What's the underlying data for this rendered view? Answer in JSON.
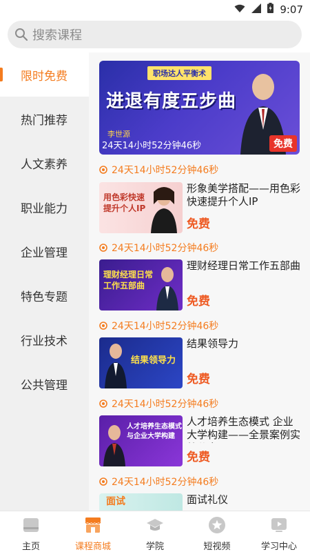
{
  "status_bar": {
    "time": "9:07"
  },
  "search": {
    "placeholder": "搜索课程"
  },
  "sidebar": {
    "items": [
      {
        "label": "限时免费",
        "active": true
      },
      {
        "label": "热门推荐"
      },
      {
        "label": "人文素养"
      },
      {
        "label": "职业能力"
      },
      {
        "label": "企业管理"
      },
      {
        "label": "特色专题"
      },
      {
        "label": "行业技术"
      },
      {
        "label": "公共管理"
      }
    ]
  },
  "banner": {
    "ribbon": "职场达人平衡术",
    "title": "进退有度五步曲",
    "speaker": "李世源",
    "countdown": "24天14小时52分钟46秒",
    "price": "免费"
  },
  "courses": [
    {
      "countdown": "24天14小时52分钟46秒",
      "title": "形象美学搭配——用色彩快速提升个人IP",
      "price": "免费",
      "thumb_text": "用色彩快速\n提升个人IP"
    },
    {
      "countdown": "24天14小时52分钟46秒",
      "title": "理财经理日常工作五部曲",
      "price": "免费",
      "thumb_text": "理财经理日常\n工作五部曲"
    },
    {
      "countdown": "24天14小时52分钟46秒",
      "title": "结果领导力",
      "price": "免费",
      "thumb_text": "结果领导力"
    },
    {
      "countdown": "24天14小时52分钟46秒",
      "title": "人才培养生态模式 企业大学构建——全景案例实战分享",
      "price": "免费",
      "thumb_text": "人才培养生态模式\n与企业大学构建"
    },
    {
      "countdown": "24天14小时52分钟46秒",
      "title": "面试礼仪",
      "price": "",
      "thumb_text": "面试"
    }
  ],
  "tabbar": {
    "items": [
      {
        "label": "主页",
        "icon": "home-icon"
      },
      {
        "label": "课程商城",
        "icon": "store-icon",
        "active": true
      },
      {
        "label": "学院",
        "icon": "graduation-cap-icon"
      },
      {
        "label": "短视频",
        "icon": "star-icon"
      },
      {
        "label": "学习中心",
        "icon": "play-icon"
      }
    ]
  },
  "colors": {
    "accent": "#f47c1f",
    "free": "#ee5b24"
  }
}
